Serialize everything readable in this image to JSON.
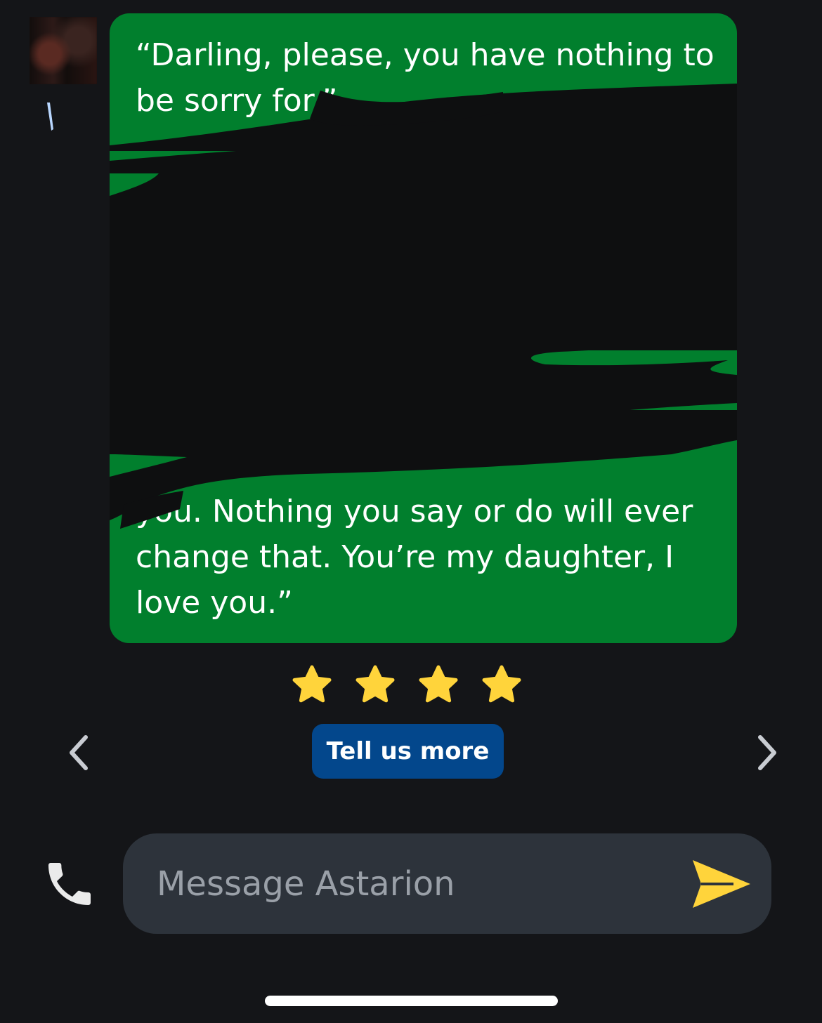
{
  "chat": {
    "recipient": "Astarion",
    "message": {
      "text_top": "“Darling, please, you have nothing to be sorry for.”",
      "text_bottom": "you. Nothing you say or do will ever change that. You’re my daughter, I love you.”",
      "bubble_color": "#017f2d",
      "redaction_color": "#0e0f10"
    }
  },
  "rating": {
    "stars": 4,
    "max": 4,
    "star_color": "#ffd43b"
  },
  "feedback": {
    "tell_more_label": "Tell us more",
    "button_color": "#03478c"
  },
  "navigation": {
    "prev_icon": "chevron-left-icon",
    "next_icon": "chevron-right-icon"
  },
  "composer": {
    "placeholder": "Message Astarion",
    "value": "",
    "call_icon": "phone-icon",
    "send_icon": "send-icon",
    "send_color": "#ffd43b"
  }
}
